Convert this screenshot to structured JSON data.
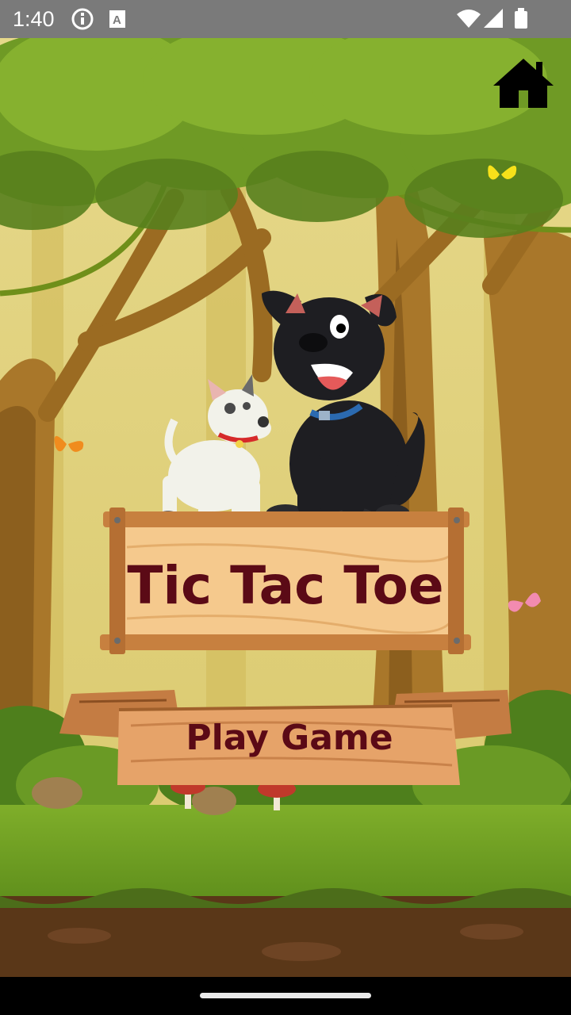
{
  "status_bar": {
    "time": "1:40",
    "icons": [
      "info-icon",
      "a11y-icon",
      "wifi-icon",
      "signal-icon",
      "battery-icon"
    ]
  },
  "header": {
    "home_icon": "home-icon"
  },
  "game": {
    "title": "Tic Tac Toe",
    "play_button_label": "Play Game"
  },
  "colors": {
    "title_text": "#5b0a16",
    "board_wood": "#f3c58c",
    "status_bar": "#7a7a7a"
  }
}
